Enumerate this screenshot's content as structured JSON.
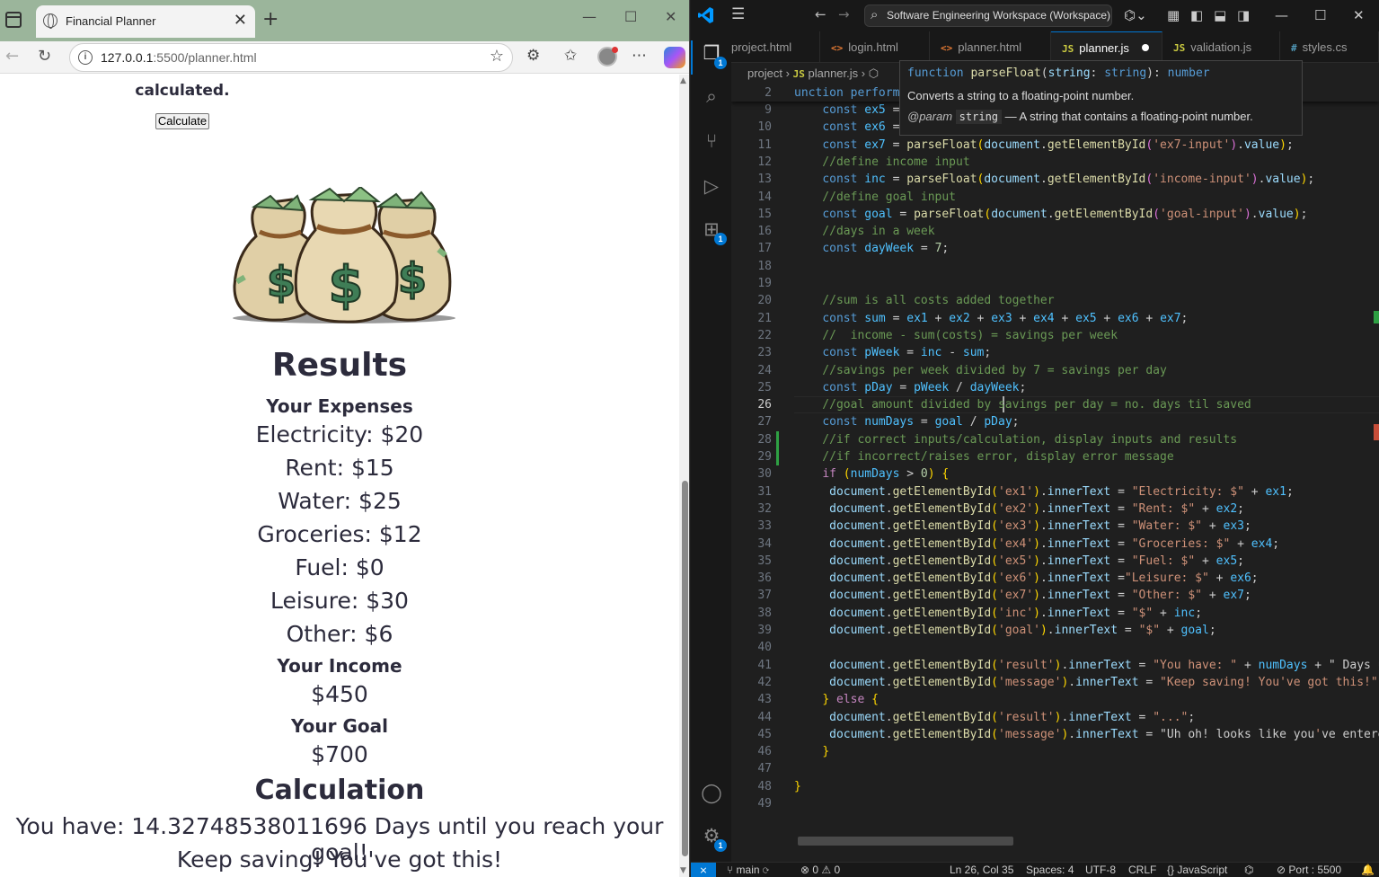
{
  "browser": {
    "tab_title": "Financial Planner",
    "tab_close": "✕",
    "new_tab": "+",
    "url_host": "127.0.0.1",
    "url_rest": ":5500/planner.html"
  },
  "page": {
    "note_text": "calculated.",
    "calculate_button": "Calculate",
    "results_heading": "Results",
    "expenses_heading": "Your Expenses",
    "expenses": [
      "Electricity: $20",
      "Rent: $15",
      "Water: $25",
      "Groceries: $12",
      "Fuel: $0",
      "Leisure: $30",
      "Other: $6"
    ],
    "income_heading": "Your Income",
    "income_value": "$450",
    "goal_heading": "Your Goal",
    "goal_value": "$700",
    "calculation_heading": "Calculation",
    "result_text": "You have: 14.32748538011696 Days until you reach your goal!",
    "message_text": "Keep saving! You've got this!"
  },
  "vscode": {
    "search_text": "Software Engineering Workspace (Workspace)",
    "tabs": [
      {
        "label": "project.html",
        "type": "html"
      },
      {
        "label": "login.html",
        "type": "html"
      },
      {
        "label": "planner.html",
        "type": "html"
      },
      {
        "label": "planner.js",
        "type": "js",
        "active": true,
        "dirty": true
      },
      {
        "label": "validation.js",
        "type": "js"
      },
      {
        "label": "styles.cs",
        "type": "css"
      }
    ],
    "breadcrumb": [
      "project",
      "planner.js"
    ],
    "hover": {
      "signature": "function parseFloat(string: string): number",
      "description": "Converts a string to a floating-point number.",
      "param_tag": "@param",
      "param_name": "string",
      "param_desc": "— A string that contains a floating-point number."
    },
    "sticky_line": {
      "num": "2",
      "text": "unction perform"
    },
    "code_lines": [
      {
        "n": "9",
        "t": "    const ex5 = "
      },
      {
        "n": "10",
        "t": "    const ex6 = "
      },
      {
        "n": "11",
        "t": "    const ex7 = parseFloat(document.getElementById('ex7-input').value);"
      },
      {
        "n": "12",
        "t": "    //define income input"
      },
      {
        "n": "13",
        "t": "    const inc = parseFloat(document.getElementById('income-input').value);"
      },
      {
        "n": "14",
        "t": "    //define goal input"
      },
      {
        "n": "15",
        "t": "    const goal = parseFloat(document.getElementById('goal-input').value);"
      },
      {
        "n": "16",
        "t": "    //days in a week"
      },
      {
        "n": "17",
        "t": "    const dayWeek = 7;"
      },
      {
        "n": "18",
        "t": ""
      },
      {
        "n": "19",
        "t": ""
      },
      {
        "n": "20",
        "t": "    //sum is all costs added together"
      },
      {
        "n": "21",
        "t": "    const sum = ex1 + ex2 + ex3 + ex4 + ex5 + ex6 + ex7;"
      },
      {
        "n": "22",
        "t": "    //  income - sum(costs) = savings per week"
      },
      {
        "n": "23",
        "t": "    const pWeek = inc - sum;"
      },
      {
        "n": "24",
        "t": "    //savings per week divided by 7 = savings per day"
      },
      {
        "n": "25",
        "t": "    const pDay = pWeek / dayWeek;"
      },
      {
        "n": "26",
        "t": "    //goal amount divided by savings per day = no. days til saved"
      },
      {
        "n": "27",
        "t": "    const numDays = goal / pDay;"
      },
      {
        "n": "28",
        "t": "    //if correct inputs/calculation, display inputs and results"
      },
      {
        "n": "29",
        "t": "    //if incorrect/raises error, display error message"
      },
      {
        "n": "30",
        "t": "    if (numDays > 0) {"
      },
      {
        "n": "31",
        "t": "     document.getElementById('ex1').innerText = \"Electricity: $\" + ex1;"
      },
      {
        "n": "32",
        "t": "     document.getElementById('ex2').innerText = \"Rent: $\" + ex2;"
      },
      {
        "n": "33",
        "t": "     document.getElementById('ex3').innerText = \"Water: $\" + ex3;"
      },
      {
        "n": "34",
        "t": "     document.getElementById('ex4').innerText = \"Groceries: $\" + ex4;"
      },
      {
        "n": "35",
        "t": "     document.getElementById('ex5').innerText = \"Fuel: $\" + ex5;"
      },
      {
        "n": "36",
        "t": "     document.getElementById('ex6').innerText =\"Leisure: $\" + ex6;"
      },
      {
        "n": "37",
        "t": "     document.getElementById('ex7').innerText = \"Other: $\" + ex7;"
      },
      {
        "n": "38",
        "t": "     document.getElementById('inc').innerText = \"$\" + inc;"
      },
      {
        "n": "39",
        "t": "     document.getElementById('goal').innerText = \"$\" + goal;"
      },
      {
        "n": "40",
        "t": ""
      },
      {
        "n": "41",
        "t": "     document.getElementById('result').innerText = \"You have: \" + numDays + \" Days u"
      },
      {
        "n": "42",
        "t": "     document.getElementById('message').innerText = \"Keep saving! You've got this!\""
      },
      {
        "n": "43",
        "t": "    } else {"
      },
      {
        "n": "44",
        "t": "     document.getElementById('result').innerText = \"...\";"
      },
      {
        "n": "45",
        "t": "     document.getElementById('message').innerText = \"Uh oh! looks like you've entere"
      },
      {
        "n": "46",
        "t": "    }"
      },
      {
        "n": "47",
        "t": ""
      },
      {
        "n": "48",
        "t": "}"
      },
      {
        "n": "49",
        "t": ""
      }
    ],
    "current_line": "26",
    "status": {
      "branch": "main",
      "errors": "0",
      "warnings": "0",
      "position": "Ln 26, Col 35",
      "spaces": "Spaces: 4",
      "encoding": "UTF-8",
      "eol": "CRLF",
      "language": "JavaScript",
      "port": "Port : 5500"
    },
    "activity_badges": {
      "explorer": "1",
      "extensions": "1",
      "settings": "1"
    }
  },
  "colors": {
    "accent": "#0078d4",
    "page_text": "#2c2b3c",
    "browser_tabbar": "#9bb59b"
  }
}
